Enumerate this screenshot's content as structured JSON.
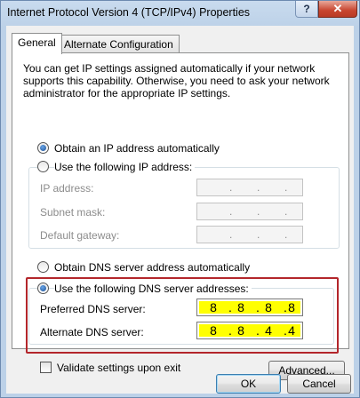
{
  "window": {
    "title": "Internet Protocol Version 4 (TCP/IPv4) Properties",
    "help_label": "?",
    "close_label": "✕"
  },
  "tabs": [
    {
      "label": "General",
      "active": true
    },
    {
      "label": "Alternate Configuration",
      "active": false
    }
  ],
  "general": {
    "description": "You can get IP settings assigned automatically if your network supports this capability. Otherwise, you need to ask your network administrator for the appropriate IP settings.",
    "ip_mode": {
      "auto_label": "Obtain an IP address automatically",
      "manual_label": "Use the following IP address:",
      "selected": "auto"
    },
    "ip_fields": [
      {
        "label": "IP address:",
        "value": [
          ".",
          ".",
          "."
        ]
      },
      {
        "label": "Subnet mask:",
        "value": [
          ".",
          ".",
          "."
        ]
      },
      {
        "label": "Default gateway:",
        "value": [
          ".",
          ".",
          "."
        ]
      }
    ],
    "dns_mode": {
      "auto_label": "Obtain DNS server address automatically",
      "manual_label": "Use the following DNS server addresses:",
      "selected": "manual"
    },
    "dns_fields": [
      {
        "label": "Preferred DNS server:",
        "octets": [
          "8",
          "8",
          "8",
          "8"
        ]
      },
      {
        "label": "Alternate DNS server:",
        "octets": [
          "8",
          "8",
          "4",
          "4"
        ]
      }
    ],
    "validate_label": "Validate settings upon exit",
    "validate_checked": false,
    "advanced_label": "Advanced..."
  },
  "buttons": {
    "ok": "OK",
    "cancel": "Cancel"
  },
  "colors": {
    "highlight_box": "#b3262b",
    "dns_field_fill": "#ffff00"
  }
}
